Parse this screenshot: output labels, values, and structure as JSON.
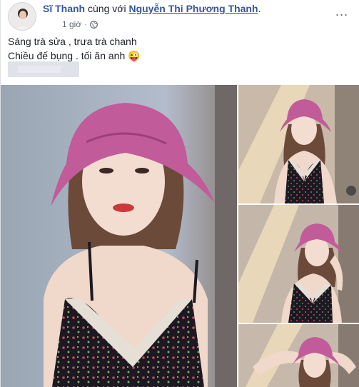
{
  "post": {
    "author": "Sĩ Thanh",
    "with_text": " cùng với ",
    "tagged": "Nguyễn Thi Phương Thanh",
    "tagged_suffix": ".",
    "time": "1 giờ",
    "dot": "·",
    "privacy_icon": "globe-icon",
    "more": "...",
    "caption_line1": "Sáng trà sửa , trưa trà chanh",
    "caption_line2": "Chiều đế bụng . tối ăn anh",
    "emoji": "😜"
  },
  "colors": {
    "link": "#365899",
    "text": "#1d2129",
    "meta": "#616770",
    "hat": "#c15b9a",
    "dress": "#1e1a24",
    "lace": "#e6dfd6"
  }
}
